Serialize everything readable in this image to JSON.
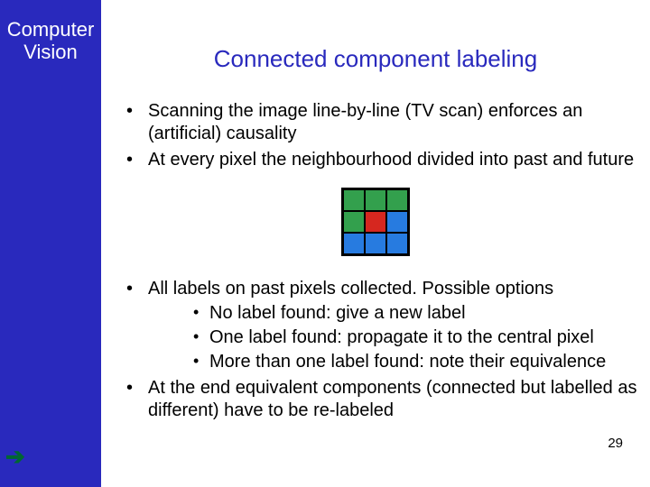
{
  "sidebar": {
    "title_line1": "Computer",
    "title_line2": "Vision",
    "arrow": "➔"
  },
  "title": "Connected component labeling",
  "bullets_top": [
    "Scanning the image line-by-line (TV scan) enforces an (artificial) causality",
    "At every pixel the neighbourhood divided into past and future"
  ],
  "grid": {
    "colors": [
      "g",
      "g",
      "g",
      "g",
      "r",
      "b",
      "b",
      "b",
      "b"
    ]
  },
  "bullets_bottom": [
    {
      "text": "All labels on past pixels collected. Possible options",
      "sub": [
        "No label found: give a new label",
        "One label found: propagate it to the central pixel",
        "More than one label found: note their equivalence"
      ]
    },
    {
      "text": "At the end equivalent components (connected but labelled as different) have to be re-labeled",
      "sub": []
    }
  ],
  "page_number": "29"
}
